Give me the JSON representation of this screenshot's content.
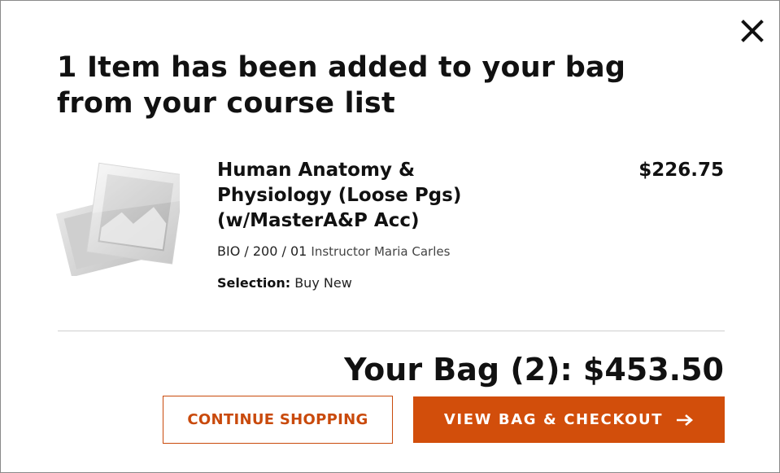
{
  "modal": {
    "headline": "1 Item has been added to your bag from your course list",
    "close_icon": "close-icon"
  },
  "item": {
    "title": "Human Anatomy & Physiology (Loose Pgs)(w/MasterA&P Acc)",
    "price": "$226.75",
    "course": "BIO / 200 / 01",
    "instructor": "Instructor Maria Carles",
    "selection_label": "Selection:",
    "selection_value": "Buy New",
    "image_icon": "book-placeholder-icon"
  },
  "bag": {
    "summary": "Your Bag (2): $453.50"
  },
  "actions": {
    "continue_label": "CONTINUE SHOPPING",
    "checkout_label": "VIEW BAG & CHECKOUT",
    "checkout_icon": "arrow-right-icon"
  },
  "colors": {
    "accent": "#d24e0b",
    "text": "#111111",
    "divider": "#cfcfcf"
  }
}
